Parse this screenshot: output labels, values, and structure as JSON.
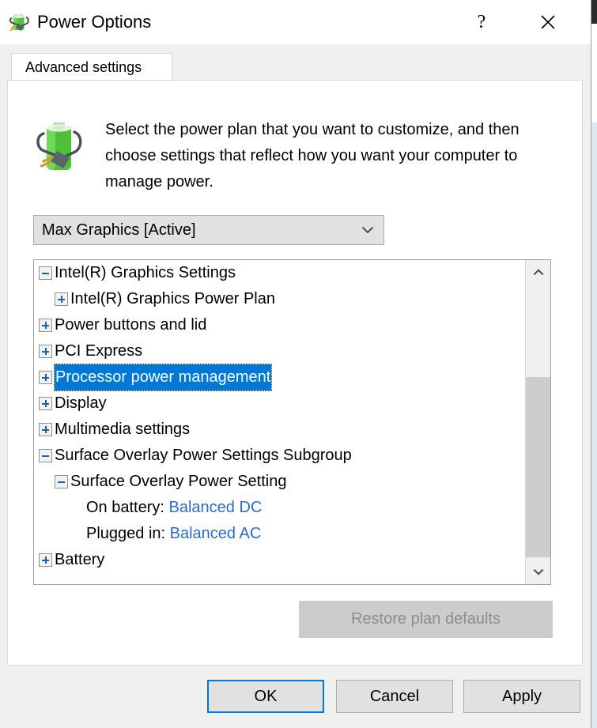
{
  "window": {
    "title": "Power Options",
    "app_icon": "battery-plug-icon",
    "help_label": "?",
    "close_label": "close-icon"
  },
  "tabs": [
    {
      "label": "Advanced settings",
      "active": true
    }
  ],
  "header": {
    "icon": "battery-plug-large-icon",
    "description": "Select the power plan that you want to customize, and then choose settings that reflect how you want your computer to manage power."
  },
  "plan_combo": {
    "selected": "Max Graphics [Active]",
    "arrow_icon": "chevron-down-icon"
  },
  "tree": {
    "selected_item": "Processor power management",
    "items": [
      {
        "label": "Intel(R) Graphics Settings",
        "level": 1,
        "state": "expanded",
        "type": "group"
      },
      {
        "label": "Intel(R) Graphics Power Plan",
        "level": 2,
        "state": "collapsed",
        "type": "group"
      },
      {
        "label": "Power buttons and lid",
        "level": 1,
        "state": "collapsed",
        "type": "group"
      },
      {
        "label": "PCI Express",
        "level": 1,
        "state": "collapsed",
        "type": "group"
      },
      {
        "label": "Processor power management",
        "level": 1,
        "state": "collapsed",
        "type": "group",
        "selected": true
      },
      {
        "label": "Display",
        "level": 1,
        "state": "collapsed",
        "type": "group"
      },
      {
        "label": "Multimedia settings",
        "level": 1,
        "state": "collapsed",
        "type": "group"
      },
      {
        "label": "Surface Overlay Power Settings Subgroup",
        "level": 1,
        "state": "expanded",
        "type": "group"
      },
      {
        "label": "Surface Overlay Power Setting",
        "level": 2,
        "state": "expanded",
        "type": "group"
      },
      {
        "label": "On battery:",
        "value": "Balanced DC",
        "level": 3,
        "state": "none",
        "type": "setting"
      },
      {
        "label": "Plugged in:",
        "value": "Balanced AC",
        "level": 3,
        "state": "none",
        "type": "setting"
      },
      {
        "label": "Battery",
        "level": 1,
        "state": "collapsed",
        "type": "group"
      }
    ]
  },
  "scrollbar": {
    "up_icon": "chevron-up-icon",
    "down_icon": "chevron-down-icon"
  },
  "buttons": {
    "restore": "Restore plan defaults",
    "restore_enabled": false,
    "ok": "OK",
    "cancel": "Cancel",
    "apply": "Apply"
  },
  "colors": {
    "accent": "#0078D7",
    "selection": "#0078D7",
    "link": "#2B6CD4",
    "expander_glyph": "#1B62B5",
    "dialog_bg": "#F0F0F0",
    "button_face": "#E1E1E1"
  }
}
